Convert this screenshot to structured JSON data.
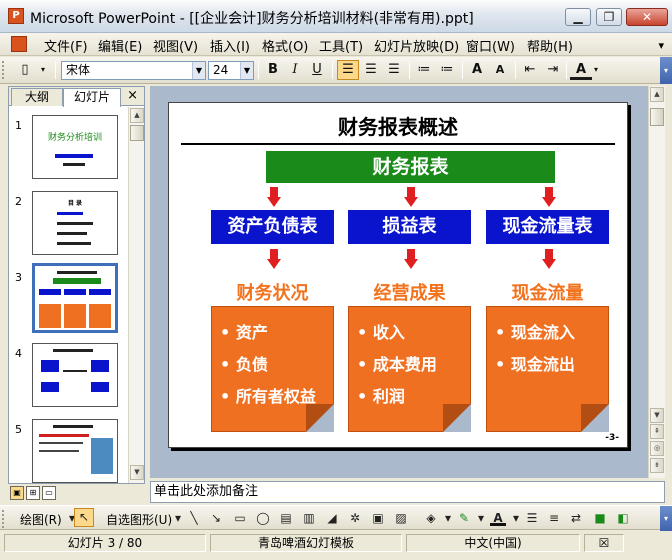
{
  "window": {
    "title": "Microsoft PowerPoint - [[企业会计]财务分析培训材料(非常有用).ppt]",
    "app_icon": "powerpoint-icon",
    "controls": {
      "minimize": "▁",
      "restore": "❐",
      "close": "✕"
    }
  },
  "menu": {
    "items": [
      "文件(F)",
      "编辑(E)",
      "视图(V)",
      "插入(I)",
      "格式(O)",
      "工具(T)",
      "幻灯片放映(D)",
      "窗口(W)",
      "帮助(H)"
    ],
    "overflow": "▾"
  },
  "format_toolbar": {
    "font_name": "宋体",
    "font_size": "24",
    "bold": "B",
    "italic": "I",
    "underline": "U",
    "increase_font": "A",
    "decrease_font": "A",
    "font_color_letter": "A",
    "align_left_active": true
  },
  "left_pane": {
    "tabs": [
      "大纲",
      "幻灯片"
    ],
    "active_tab": "幻灯片",
    "close_glyph": "×",
    "slides": [
      {
        "number": "1",
        "title": "财务分析培训"
      },
      {
        "number": "2",
        "title": "目 录"
      },
      {
        "number": "3",
        "title": "财务报表概述",
        "selected": true
      },
      {
        "number": "4",
        "title": ""
      },
      {
        "number": "5",
        "title": ""
      }
    ]
  },
  "slide": {
    "title": "财务报表概述",
    "top_box": "财务报表",
    "statements": [
      "资产负债表",
      "损益表",
      "现金流量表"
    ],
    "categories": [
      "财务状况",
      "经营成果",
      "现金流量"
    ],
    "boxes": [
      [
        "资产",
        "负债",
        "所有者权益"
      ],
      [
        "收入",
        "成本费用",
        "利润"
      ],
      [
        "现金流入",
        "现金流出"
      ]
    ],
    "bullet_char": "•",
    "page_marker": "-3-",
    "colors": {
      "green": "#1a8a1a",
      "blue": "#0a14cc",
      "orange": "#f07022",
      "red": "#e02020"
    }
  },
  "notes": {
    "placeholder": "单击此处添加备注"
  },
  "draw_toolbar": {
    "draw_label": "绘图(R)",
    "autoshapes_label": "自选图形(U)"
  },
  "status": {
    "slide_info": "幻灯片 3 / 80",
    "template": "青岛啤酒幻灯模板",
    "language": "中文(中国)"
  }
}
